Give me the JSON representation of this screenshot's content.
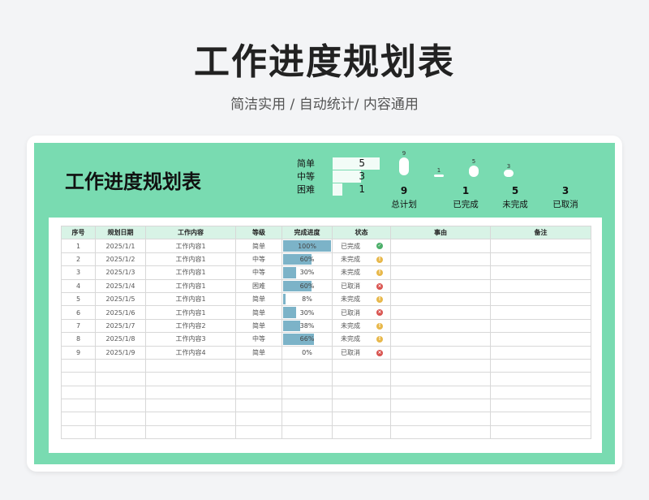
{
  "header": {
    "title": "工作进度规划表",
    "subtitle": "简洁实用 / 自动统计/ 内容通用"
  },
  "sheet": {
    "title": "工作进度规划表",
    "levels": [
      {
        "label": "简单",
        "value": "5",
        "fraction": 1.0
      },
      {
        "label": "中等",
        "value": "3",
        "fraction": 0.6
      },
      {
        "label": "困难",
        "value": "1",
        "fraction": 0.2
      }
    ],
    "stats": [
      {
        "value": "9",
        "label": "总计划"
      },
      {
        "value": "1",
        "label": "已完成"
      },
      {
        "value": "5",
        "label": "未完成"
      },
      {
        "value": "3",
        "label": "已取消"
      }
    ],
    "mini_chart_labels": [
      "9",
      "1",
      "5",
      "3"
    ]
  },
  "colors": {
    "sheet_bg": "#79dbb1",
    "header_bg": "#d8f3e6",
    "progress_bar": "#7cb3c8",
    "done": "#4caf6a",
    "pending": "#e8b84a",
    "cancelled": "#d9534f"
  },
  "table": {
    "columns": [
      "序号",
      "规划日期",
      "工作内容",
      "等级",
      "完成进度",
      "状态",
      "事由",
      "备注"
    ],
    "rows": [
      {
        "no": "1",
        "date": "2025/1/1",
        "content": "工作内容1",
        "level": "简单",
        "progress": "100%",
        "progress_value": 1.0,
        "status": "已完成",
        "status_icon": "check-icon",
        "status_color": "#4caf6a"
      },
      {
        "no": "2",
        "date": "2025/1/2",
        "content": "工作内容1",
        "level": "中等",
        "progress": "60%",
        "progress_value": 0.6,
        "status": "未完成",
        "status_icon": "pending-icon",
        "status_color": "#e8b84a"
      },
      {
        "no": "3",
        "date": "2025/1/3",
        "content": "工作内容1",
        "level": "中等",
        "progress": "30%",
        "progress_value": 0.3,
        "status": "未完成",
        "status_icon": "pending-icon",
        "status_color": "#e8b84a"
      },
      {
        "no": "4",
        "date": "2025/1/4",
        "content": "工作内容1",
        "level": "困难",
        "progress": "60%",
        "progress_value": 0.6,
        "status": "已取消",
        "status_icon": "cancel-icon",
        "status_color": "#d9534f"
      },
      {
        "no": "5",
        "date": "2025/1/5",
        "content": "工作内容1",
        "level": "简单",
        "progress": "8%",
        "progress_value": 0.08,
        "status": "未完成",
        "status_icon": "pending-icon",
        "status_color": "#e8b84a"
      },
      {
        "no": "6",
        "date": "2025/1/6",
        "content": "工作内容1",
        "level": "简单",
        "progress": "30%",
        "progress_value": 0.3,
        "status": "已取消",
        "status_icon": "cancel-icon",
        "status_color": "#d9534f"
      },
      {
        "no": "7",
        "date": "2025/1/7",
        "content": "工作内容2",
        "level": "简单",
        "progress": "38%",
        "progress_value": 0.38,
        "status": "未完成",
        "status_icon": "pending-icon",
        "status_color": "#e8b84a"
      },
      {
        "no": "8",
        "date": "2025/1/8",
        "content": "工作内容3",
        "level": "中等",
        "progress": "66%",
        "progress_value": 0.66,
        "status": "未完成",
        "status_icon": "pending-icon",
        "status_color": "#e8b84a"
      },
      {
        "no": "9",
        "date": "2025/1/9",
        "content": "工作内容4",
        "level": "简单",
        "progress": "0%",
        "progress_value": 0.0,
        "status": "已取消",
        "status_icon": "cancel-icon",
        "status_color": "#d9534f"
      }
    ],
    "empty_rows": 6
  }
}
